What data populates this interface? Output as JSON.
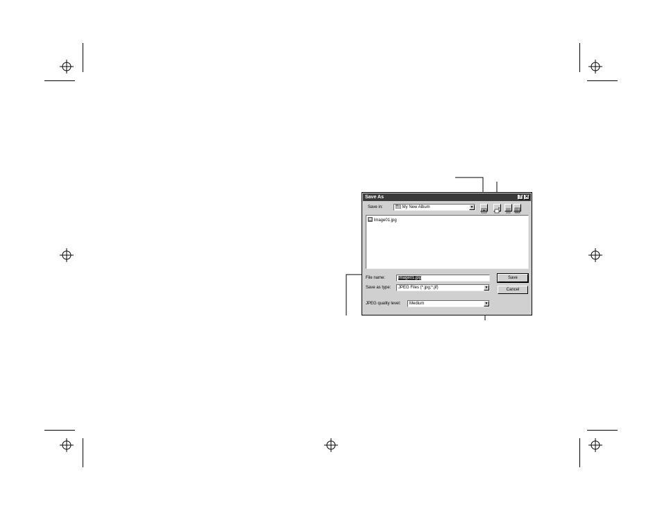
{
  "dialog": {
    "title": "Save As",
    "help_glyph": "?",
    "close_glyph": "✕",
    "save_in_label": "Save in:",
    "save_in_value": "My New Album",
    "files": [
      {
        "name": "Image01.jpg"
      }
    ],
    "file_name_label": "File name:",
    "file_name_value": "Image01.jpg",
    "save_as_type_label": "Save as type:",
    "save_as_type_value": "JPEG Files (*.jpg;*.jif)",
    "quality_label": "JPEG quality level:",
    "quality_value": "Medium",
    "save_button": "Save",
    "cancel_button": "Cancel",
    "dropdown_glyph": "▼"
  },
  "icons": {
    "up_folder": "up-one-level-icon",
    "new_folder": "create-new-folder-icon",
    "list_view": "list-view-icon",
    "details_view": "details-view-icon",
    "folder": "folder-icon",
    "file": "jpeg-file-icon"
  },
  "colors": {
    "titlebar": "#3a3a3a",
    "dialog_face": "#d0d0d0",
    "selection": "#222222"
  }
}
